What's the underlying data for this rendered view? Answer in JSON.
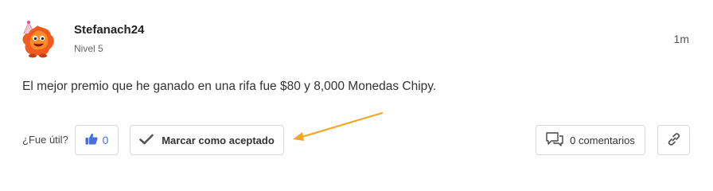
{
  "post": {
    "author": "Stefanach24",
    "level": "Nivel 5",
    "timestamp": "1m",
    "body": "El mejor premio que he ganado en una rifa fue $80 y 8,000 Monedas Chipy."
  },
  "actions": {
    "helpful_label": "¿Fue útil?",
    "like_count": "0",
    "accept_label": "Marcar como aceptado",
    "comments_label": "0 comentarios"
  },
  "icons": {
    "like": "thumbs-up-icon",
    "accept": "checkmark-icon",
    "comments": "comment-bubble-icon",
    "link": "link-icon",
    "annotation": "arrow-annotation"
  },
  "colors": {
    "like_accent": "#4a6fd8",
    "annotation_arrow": "#f5a623",
    "avatar_orange": "#f05a1e"
  }
}
